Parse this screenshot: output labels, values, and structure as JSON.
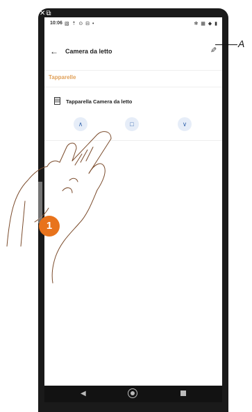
{
  "status_bar": {
    "time": "10:06",
    "left_icons": "▧ ⇡ ⊙ ⊟ •",
    "right_icons": "✻ ▦ ◆ ▮"
  },
  "corner_icons": "✕⧉",
  "header": {
    "title": "Camera da letto"
  },
  "section": {
    "label": "Tapparelle"
  },
  "device": {
    "name": "Tapparella Camera da letto"
  },
  "controls": {
    "up": "∧",
    "stop": "□",
    "down": "∨"
  },
  "callout": {
    "label": "A"
  },
  "step": {
    "number": "1"
  },
  "colors": {
    "accent": "#e0a058",
    "control_bg": "#e6edf8",
    "control_fg": "#3c6bb0",
    "badge": "#e8731c"
  }
}
